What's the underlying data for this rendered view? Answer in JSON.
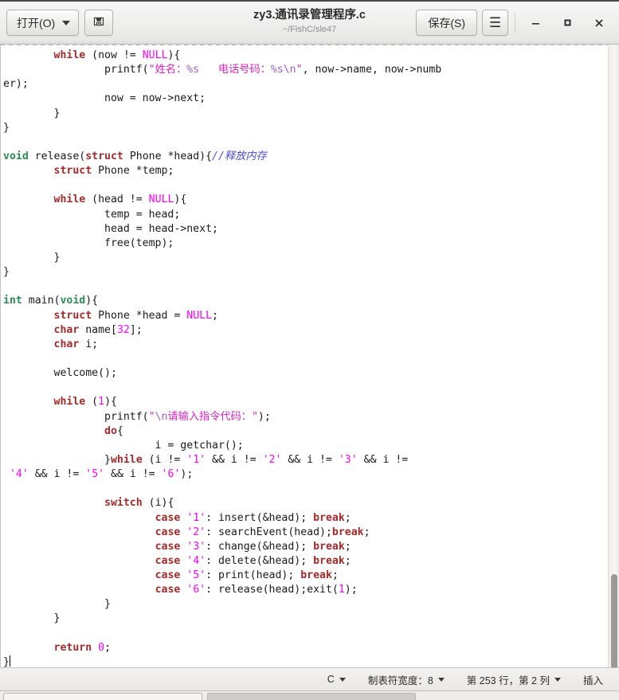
{
  "window": {
    "title": "zy3.通讯录管理程序.c",
    "subtitle": "~/FishC/sle47",
    "open_label": "打开(O)",
    "save_label": "保存(S)",
    "menu_glyph": "☰",
    "newfile_icon": "save-as-icon",
    "minimize_glyph": "–",
    "maximize_glyph": "□",
    "close_glyph": "✕"
  },
  "statusbar": {
    "language": "C",
    "tab_width": "制表符宽度：8",
    "position": "第 253 行，第 2 列",
    "insert_mode": "插入"
  },
  "editor": {
    "language": "c",
    "cursor_line": 253,
    "cursor_column": 2,
    "tab_width": 8,
    "lines": [
      "        while (now != NULL){",
      "                printf(\"姓名：%s   电话号码：%s\\n\", now->name, now->number);",
      "                now = now->next;",
      "        }",
      "}",
      "",
      "void release(struct Phone *head){//释放内存",
      "        struct Phone *temp;",
      "",
      "        while (head != NULL){",
      "                temp = head;",
      "                head = head->next;",
      "                free(temp);",
      "        }",
      "}",
      "",
      "int main(void){",
      "        struct Phone *head = NULL;",
      "        char name[32];",
      "        char i;",
      "",
      "        welcome();",
      "",
      "        while (1){",
      "                printf(\"\\n请输入指令代码：\");",
      "                do{",
      "                        i = getchar();",
      "                }while (i != '1' && i != '2' && i != '3' && i != '4' && i != '5' && i != '6');",
      "",
      "                switch (i){",
      "                        case '1': insert(&head); break;",
      "                        case '2': searchEvent(head);break;",
      "                        case '3': change(&head); break;",
      "                        case '4': delete(&head); break;",
      "                        case '5': print(head); break;",
      "                        case '6': release(head);exit(1);",
      "                }",
      "        }",
      "",
      "        return 0;",
      "}"
    ]
  },
  "colors": {
    "keyword": "#a52a2a",
    "type": "#2e8b57",
    "literal": "#ff00ff",
    "string": "#d926c4",
    "escape": "#9b5fd0",
    "comment": "#4a4ae0",
    "background": "#ffffff",
    "chrome": "#e8e8e7"
  }
}
